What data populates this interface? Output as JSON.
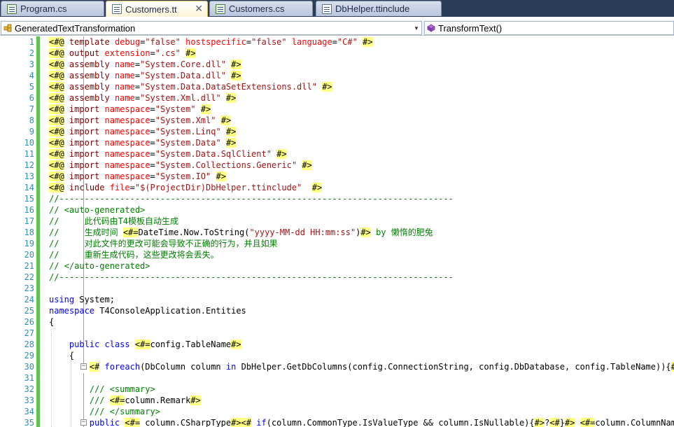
{
  "tabs": [
    {
      "label": "Program.cs",
      "icon": "csharp-file-icon",
      "active": false
    },
    {
      "label": "Customers.tt",
      "icon": "text-template-file-icon",
      "active": true,
      "close": "✕"
    },
    {
      "label": "Customers.cs",
      "icon": "csharp-file-icon",
      "active": false
    },
    {
      "label": "DbHelper.ttinclude",
      "icon": "text-template-file-icon",
      "active": false
    }
  ],
  "navigation": {
    "type_combo": "GeneratedTextTransformation",
    "member_combo": "TransformText()"
  },
  "editor": {
    "line_numbers": [
      "1",
      "2",
      "3",
      "4",
      "5",
      "6",
      "7",
      "8",
      "9",
      "10",
      "11",
      "12",
      "13",
      "14",
      "15",
      "16",
      "17",
      "18",
      "19",
      "20",
      "21",
      "22",
      "23",
      "24",
      "25",
      "26",
      "27",
      "28",
      "29",
      "30",
      "31",
      "32",
      "33",
      "34",
      "35"
    ],
    "lines": [
      [
        [
          "dlm",
          "<#@"
        ],
        [
          "plain",
          " "
        ],
        [
          "dr",
          "template"
        ],
        [
          "plain",
          " "
        ],
        [
          "at",
          "debug"
        ],
        [
          "plain",
          "="
        ],
        [
          "str",
          "\"false\""
        ],
        [
          "plain",
          " "
        ],
        [
          "at",
          "hostspecific"
        ],
        [
          "plain",
          "="
        ],
        [
          "str",
          "\"false\""
        ],
        [
          "plain",
          " "
        ],
        [
          "at",
          "language"
        ],
        [
          "plain",
          "="
        ],
        [
          "str",
          "\"C#\""
        ],
        [
          "plain",
          " "
        ],
        [
          "dlm",
          "#>"
        ]
      ],
      [
        [
          "dlm",
          "<#@"
        ],
        [
          "plain",
          " "
        ],
        [
          "dr",
          "output"
        ],
        [
          "plain",
          " "
        ],
        [
          "at",
          "extension"
        ],
        [
          "plain",
          "="
        ],
        [
          "str",
          "\".cs\""
        ],
        [
          "plain",
          " "
        ],
        [
          "dlm",
          "#>"
        ]
      ],
      [
        [
          "dlm",
          "<#@"
        ],
        [
          "plain",
          " "
        ],
        [
          "dr",
          "assembly"
        ],
        [
          "plain",
          " "
        ],
        [
          "at",
          "name"
        ],
        [
          "plain",
          "="
        ],
        [
          "str",
          "\"System.Core.dll\""
        ],
        [
          "plain",
          " "
        ],
        [
          "dlm",
          "#>"
        ]
      ],
      [
        [
          "dlm",
          "<#@"
        ],
        [
          "plain",
          " "
        ],
        [
          "dr",
          "assembly"
        ],
        [
          "plain",
          " "
        ],
        [
          "at",
          "name"
        ],
        [
          "plain",
          "="
        ],
        [
          "str",
          "\"System.Data.dll\""
        ],
        [
          "plain",
          " "
        ],
        [
          "dlm",
          "#>"
        ]
      ],
      [
        [
          "dlm",
          "<#@"
        ],
        [
          "plain",
          " "
        ],
        [
          "dr",
          "assembly"
        ],
        [
          "plain",
          " "
        ],
        [
          "at",
          "name"
        ],
        [
          "plain",
          "="
        ],
        [
          "str",
          "\"System.Data.DataSetExtensions.dll\""
        ],
        [
          "plain",
          " "
        ],
        [
          "dlm",
          "#>"
        ]
      ],
      [
        [
          "dlm",
          "<#@"
        ],
        [
          "plain",
          " "
        ],
        [
          "dr",
          "assembly"
        ],
        [
          "plain",
          " "
        ],
        [
          "at",
          "name"
        ],
        [
          "plain",
          "="
        ],
        [
          "str",
          "\"System.Xml.dll\""
        ],
        [
          "plain",
          " "
        ],
        [
          "dlm",
          "#>"
        ]
      ],
      [
        [
          "dlm",
          "<#@"
        ],
        [
          "plain",
          " "
        ],
        [
          "dr",
          "import"
        ],
        [
          "plain",
          " "
        ],
        [
          "at",
          "namespace"
        ],
        [
          "plain",
          "="
        ],
        [
          "str",
          "\"System\""
        ],
        [
          "plain",
          " "
        ],
        [
          "dlm",
          "#>"
        ]
      ],
      [
        [
          "dlm",
          "<#@"
        ],
        [
          "plain",
          " "
        ],
        [
          "dr",
          "import"
        ],
        [
          "plain",
          " "
        ],
        [
          "at",
          "namespace"
        ],
        [
          "plain",
          "="
        ],
        [
          "str",
          "\"System.Xml\""
        ],
        [
          "plain",
          " "
        ],
        [
          "dlm",
          "#>"
        ]
      ],
      [
        [
          "dlm",
          "<#@"
        ],
        [
          "plain",
          " "
        ],
        [
          "dr",
          "import"
        ],
        [
          "plain",
          " "
        ],
        [
          "at",
          "namespace"
        ],
        [
          "plain",
          "="
        ],
        [
          "str",
          "\"System.Linq\""
        ],
        [
          "plain",
          " "
        ],
        [
          "dlm",
          "#>"
        ]
      ],
      [
        [
          "dlm",
          "<#@"
        ],
        [
          "plain",
          " "
        ],
        [
          "dr",
          "import"
        ],
        [
          "plain",
          " "
        ],
        [
          "at",
          "namespace"
        ],
        [
          "plain",
          "="
        ],
        [
          "str",
          "\"System.Data\""
        ],
        [
          "plain",
          " "
        ],
        [
          "dlm",
          "#>"
        ]
      ],
      [
        [
          "dlm",
          "<#@"
        ],
        [
          "plain",
          " "
        ],
        [
          "dr",
          "import"
        ],
        [
          "plain",
          " "
        ],
        [
          "at",
          "namespace"
        ],
        [
          "plain",
          "="
        ],
        [
          "str",
          "\"System.Data.SqlClient\""
        ],
        [
          "plain",
          " "
        ],
        [
          "dlm",
          "#>"
        ]
      ],
      [
        [
          "dlm",
          "<#@"
        ],
        [
          "plain",
          " "
        ],
        [
          "dr",
          "import"
        ],
        [
          "plain",
          " "
        ],
        [
          "at",
          "namespace"
        ],
        [
          "plain",
          "="
        ],
        [
          "str",
          "\"System.Collections.Generic\""
        ],
        [
          "plain",
          " "
        ],
        [
          "dlm",
          "#>"
        ]
      ],
      [
        [
          "dlm",
          "<#@"
        ],
        [
          "plain",
          " "
        ],
        [
          "dr",
          "import"
        ],
        [
          "plain",
          " "
        ],
        [
          "at",
          "namespace"
        ],
        [
          "plain",
          "="
        ],
        [
          "str",
          "\"System.IO\""
        ],
        [
          "plain",
          " "
        ],
        [
          "dlm",
          "#>"
        ]
      ],
      [
        [
          "dlm",
          "<#@"
        ],
        [
          "plain",
          " "
        ],
        [
          "dr",
          "include"
        ],
        [
          "plain",
          " "
        ],
        [
          "at",
          "file"
        ],
        [
          "plain",
          "="
        ],
        [
          "str",
          "\"$(ProjectDir)DbHelper.ttinclude\""
        ],
        [
          "plain",
          "  "
        ],
        [
          "dlm",
          "#>"
        ]
      ],
      [
        [
          "cm",
          "//------------------------------------------------------------------------------"
        ]
      ],
      [
        [
          "cm",
          "// <auto-generated>"
        ]
      ],
      [
        [
          "cm",
          "//     此代码由T4模板自动生成"
        ]
      ],
      [
        [
          "cm",
          "//     生成时间 "
        ],
        [
          "dlm",
          "<#="
        ],
        [
          "plain",
          "DateTime.Now.ToString("
        ],
        [
          "str",
          "\"yyyy-MM-dd HH:mm:ss\""
        ],
        [
          "plain",
          ")"
        ],
        [
          "dlm",
          "#>"
        ],
        [
          "cm",
          " by 懒惰的肥兔"
        ]
      ],
      [
        [
          "cm",
          "//     对此文件的更改可能会导致不正确的行为，并且如果"
        ]
      ],
      [
        [
          "cm",
          "//     重新生成代码，这些更改将会丢失。"
        ]
      ],
      [
        [
          "cm",
          "// </auto-generated>"
        ]
      ],
      [
        [
          "cm",
          "//------------------------------------------------------------------------------"
        ]
      ],
      [],
      [
        [
          "kw",
          "using"
        ],
        [
          "plain",
          " System;"
        ]
      ],
      [
        [
          "kw",
          "namespace"
        ],
        [
          "plain",
          " T4ConsoleApplication.Entities"
        ]
      ],
      [
        [
          "plain",
          "{"
        ]
      ],
      [],
      [
        [
          "plain",
          "    "
        ],
        [
          "kw",
          "public"
        ],
        [
          "plain",
          " "
        ],
        [
          "kw",
          "class"
        ],
        [
          "plain",
          " "
        ],
        [
          "dlm",
          "<#="
        ],
        [
          "plain",
          "config.TableName"
        ],
        [
          "dlm",
          "#>"
        ]
      ],
      [
        [
          "plain",
          "    {"
        ]
      ],
      [
        [
          "plain",
          "        "
        ],
        [
          "dlm",
          "<#"
        ],
        [
          "plain",
          " "
        ],
        [
          "kw",
          "foreach"
        ],
        [
          "plain",
          "(DbColumn column "
        ],
        [
          "kw",
          "in"
        ],
        [
          "plain",
          " DbHelper.GetDbColumns(config.ConnectionString, config.DbDatabase, config.TableName)){"
        ],
        [
          "dlm",
          "#>"
        ]
      ],
      [],
      [
        [
          "plain",
          "        "
        ],
        [
          "cm",
          "/// <summary>"
        ]
      ],
      [
        [
          "plain",
          "        "
        ],
        [
          "cm",
          "/// "
        ],
        [
          "dlm",
          "<#="
        ],
        [
          "plain",
          "column.Remark"
        ],
        [
          "dlm",
          "#>"
        ]
      ],
      [
        [
          "plain",
          "        "
        ],
        [
          "cm",
          "/// </summary>"
        ]
      ],
      [
        [
          "plain",
          "        "
        ],
        [
          "kw",
          "public"
        ],
        [
          "plain",
          " "
        ],
        [
          "dlm",
          "<#="
        ],
        [
          "plain",
          " column.CSharpType"
        ],
        [
          "dlm",
          "#>"
        ],
        [
          "dlm",
          "<#"
        ],
        [
          "plain",
          " "
        ],
        [
          "kw",
          "if"
        ],
        [
          "plain",
          "(column.CommonType.IsValueType && column.IsNullable){"
        ],
        [
          "dlm",
          "#>"
        ],
        [
          "plain",
          "?"
        ],
        [
          "dlm",
          "<#"
        ],
        [
          "plain",
          "}"
        ],
        [
          "dlm",
          "#>"
        ],
        [
          "plain",
          " "
        ],
        [
          "dlm",
          "<#="
        ],
        [
          "plain",
          "column.ColumnName"
        ],
        [
          "dlm",
          "#>"
        ]
      ]
    ]
  }
}
